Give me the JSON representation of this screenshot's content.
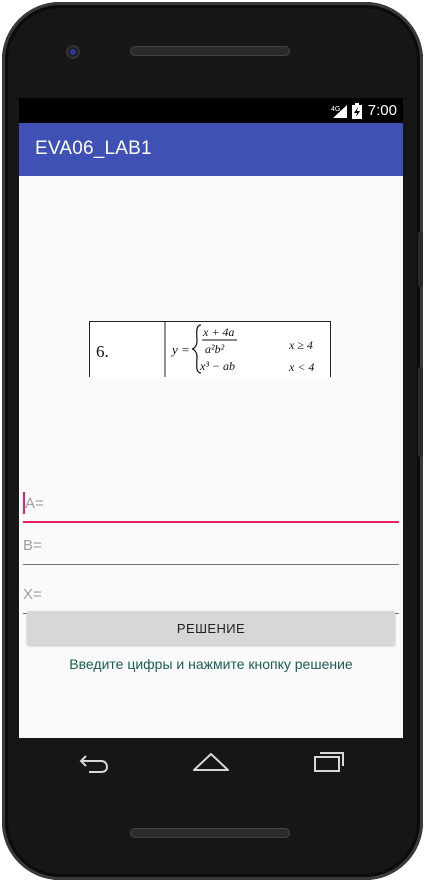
{
  "status_bar": {
    "network": "4G",
    "time": "7:00"
  },
  "app_bar": {
    "title": "EVA06_LAB1",
    "color": "#3F51B5"
  },
  "formula": {
    "number": "6.",
    "lhs": "y =",
    "case1_num": "x + 4a",
    "case1_den": "a²b²",
    "case1_cond": "x ≥ 4",
    "case2_expr": "x³ − ab",
    "case2_cond": "x < 4"
  },
  "fields": {
    "a_label": "A=",
    "b_label": "B=",
    "x_label": "X=",
    "focus_color": "#E91E63"
  },
  "solve_button": {
    "label": "РЕШЕНИЕ"
  },
  "hint_text": "Введите цифры и нажмите кнопку решение",
  "nav": {
    "icons": [
      "back-icon",
      "home-icon",
      "recents-icon"
    ]
  }
}
